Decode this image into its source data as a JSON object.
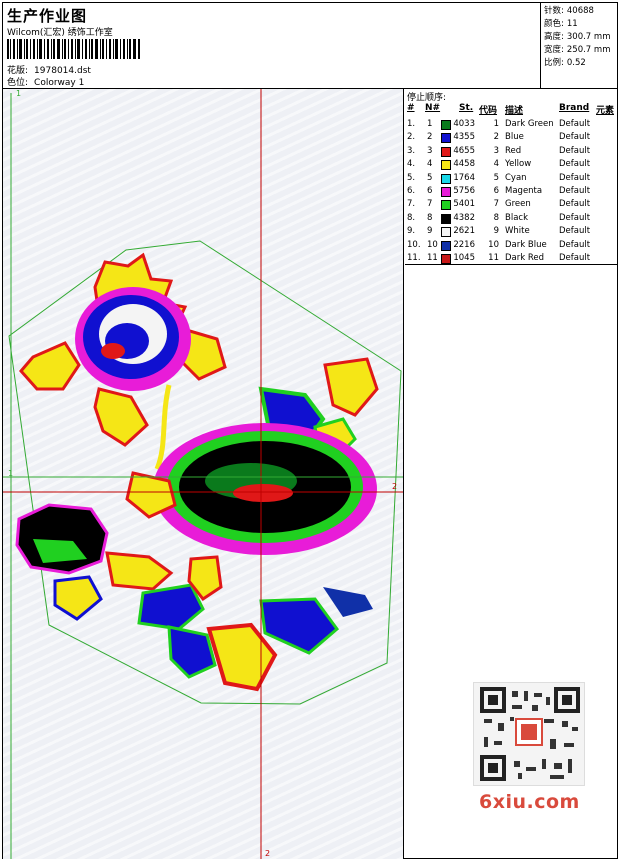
{
  "header": {
    "title": "生产作业图",
    "subtitle": "Wilcom(汇宏) 绣饰工作室",
    "design_label": "花版:",
    "design_file": "1978014.dst",
    "colorway_label": "色位:",
    "colorway": "Colorway 1"
  },
  "stats": [
    {
      "label": "针数:",
      "value": "40688"
    },
    {
      "label": "颜色:",
      "value": "11"
    },
    {
      "label": "高度:",
      "value": "300.7 mm"
    },
    {
      "label": "宽度:",
      "value": "250.7 mm"
    },
    {
      "label": "比例:",
      "value": "0.52"
    }
  ],
  "canvas": {
    "marker_top": "1",
    "marker_left": "1",
    "marker_right": "2",
    "marker_bottom": "2",
    "guide_color": "#c00000",
    "outline_color": "#33aa33"
  },
  "stop_sequence": {
    "title": "停止顺序:",
    "columns": [
      "#",
      "N#",
      "St.",
      "代码",
      "描述",
      "Brand",
      "元素"
    ],
    "rows": [
      {
        "stop": "1.",
        "n": "1",
        "stitches": "4033",
        "code": "1",
        "desc": "Dark Green",
        "brand": "Default",
        "color": "#0a7a1c"
      },
      {
        "stop": "2.",
        "n": "2",
        "stitches": "4355",
        "code": "2",
        "desc": "Blue",
        "brand": "Default",
        "color": "#1010d0"
      },
      {
        "stop": "3.",
        "n": "3",
        "stitches": "4655",
        "code": "3",
        "desc": "Red",
        "brand": "Default",
        "color": "#e01818"
      },
      {
        "stop": "4.",
        "n": "4",
        "stitches": "4458",
        "code": "4",
        "desc": "Yellow",
        "brand": "Default",
        "color": "#f5e616"
      },
      {
        "stop": "5.",
        "n": "5",
        "stitches": "1764",
        "code": "5",
        "desc": "Cyan",
        "brand": "Default",
        "color": "#18d8e8"
      },
      {
        "stop": "6.",
        "n": "6",
        "stitches": "5756",
        "code": "6",
        "desc": "Magenta",
        "brand": "Default",
        "color": "#e81cd8"
      },
      {
        "stop": "7.",
        "n": "7",
        "stitches": "5401",
        "code": "7",
        "desc": "Green",
        "brand": "Default",
        "color": "#20d020"
      },
      {
        "stop": "8.",
        "n": "8",
        "stitches": "4382",
        "code": "8",
        "desc": "Black",
        "brand": "Default",
        "color": "#000000"
      },
      {
        "stop": "9.",
        "n": "9",
        "stitches": "2621",
        "code": "9",
        "desc": "White",
        "brand": "Default",
        "color": "#f4f4f4"
      },
      {
        "stop": "10.",
        "n": "10",
        "stitches": "2216",
        "code": "10",
        "desc": "Dark Blue",
        "brand": "Default",
        "color": "#1030a8"
      },
      {
        "stop": "11.",
        "n": "11",
        "stitches": "1045",
        "code": "11",
        "desc": "Dark Red",
        "brand": "Default",
        "color": "#c81818"
      }
    ]
  },
  "watermark": {
    "text": "6xiu.com",
    "qr_icon": "qr-code-icon"
  }
}
